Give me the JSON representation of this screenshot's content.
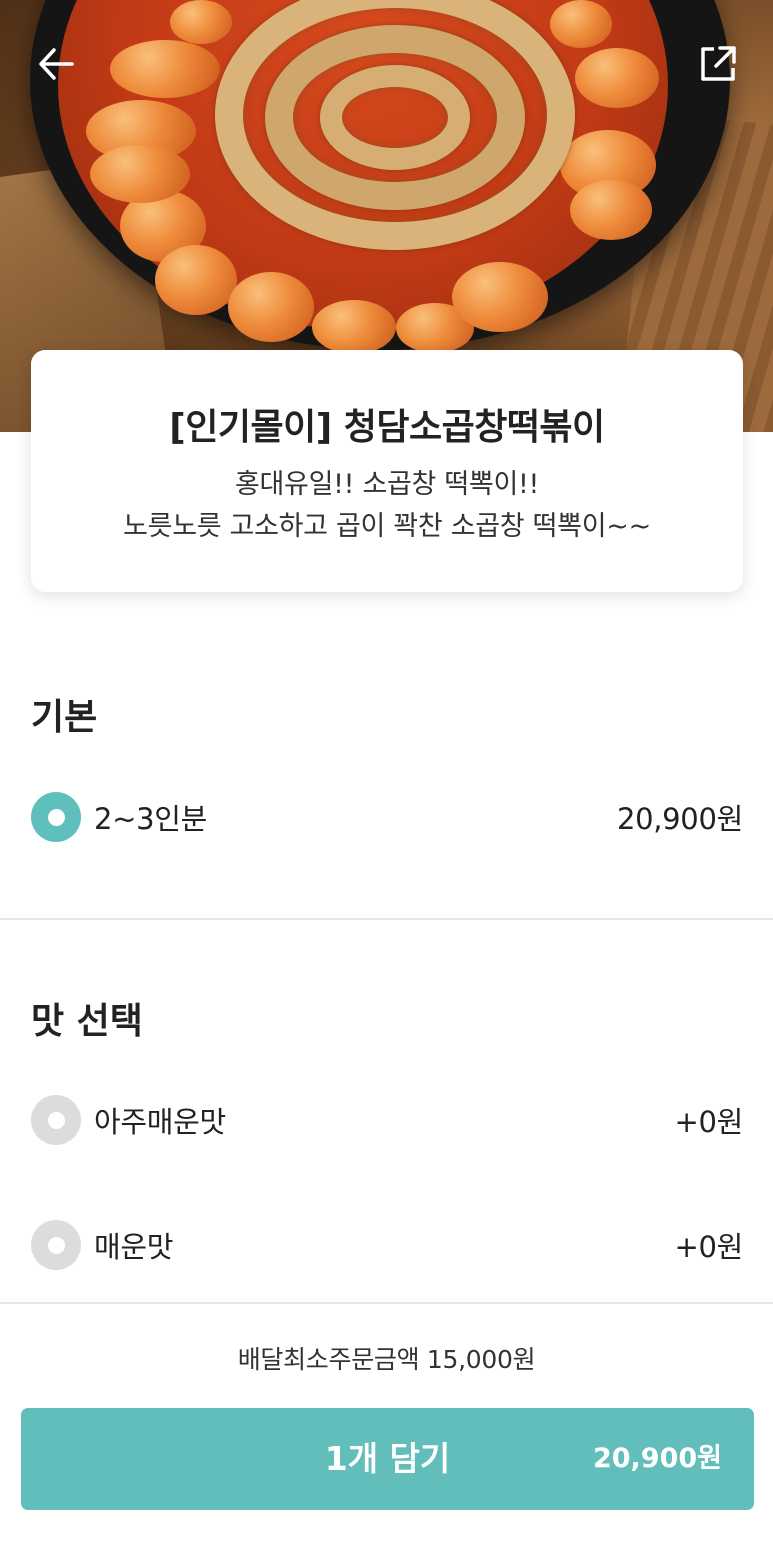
{
  "header": {
    "back_icon": "arrow-left-icon",
    "share_icon": "share-external-icon"
  },
  "menu": {
    "title": "[인기몰이] 청담소곱창떡볶이",
    "description_line1": "홍대유일!! 소곱창 떡뽁이!!",
    "description_line2": "노릇노릇 고소하고 곱이 꽉찬 소곱창 떡뽁이~~"
  },
  "sections": {
    "basic": {
      "title": "기본",
      "options": [
        {
          "label": "2~3인분",
          "price": "20,900원",
          "selected": true
        }
      ]
    },
    "taste": {
      "title": "맛 선택",
      "options": [
        {
          "label": "아주매운맛",
          "price": "+0원",
          "selected": false
        },
        {
          "label": "매운맛",
          "price": "+0원",
          "selected": false
        }
      ]
    }
  },
  "footer": {
    "min_order": "배달최소주문금액 15,000원",
    "cart_label": "1개 담기",
    "cart_price": "20,900원"
  },
  "colors": {
    "accent": "#62bebb",
    "radio_selected": "#5ebfbc",
    "radio_unselected": "#dcdcdc"
  }
}
